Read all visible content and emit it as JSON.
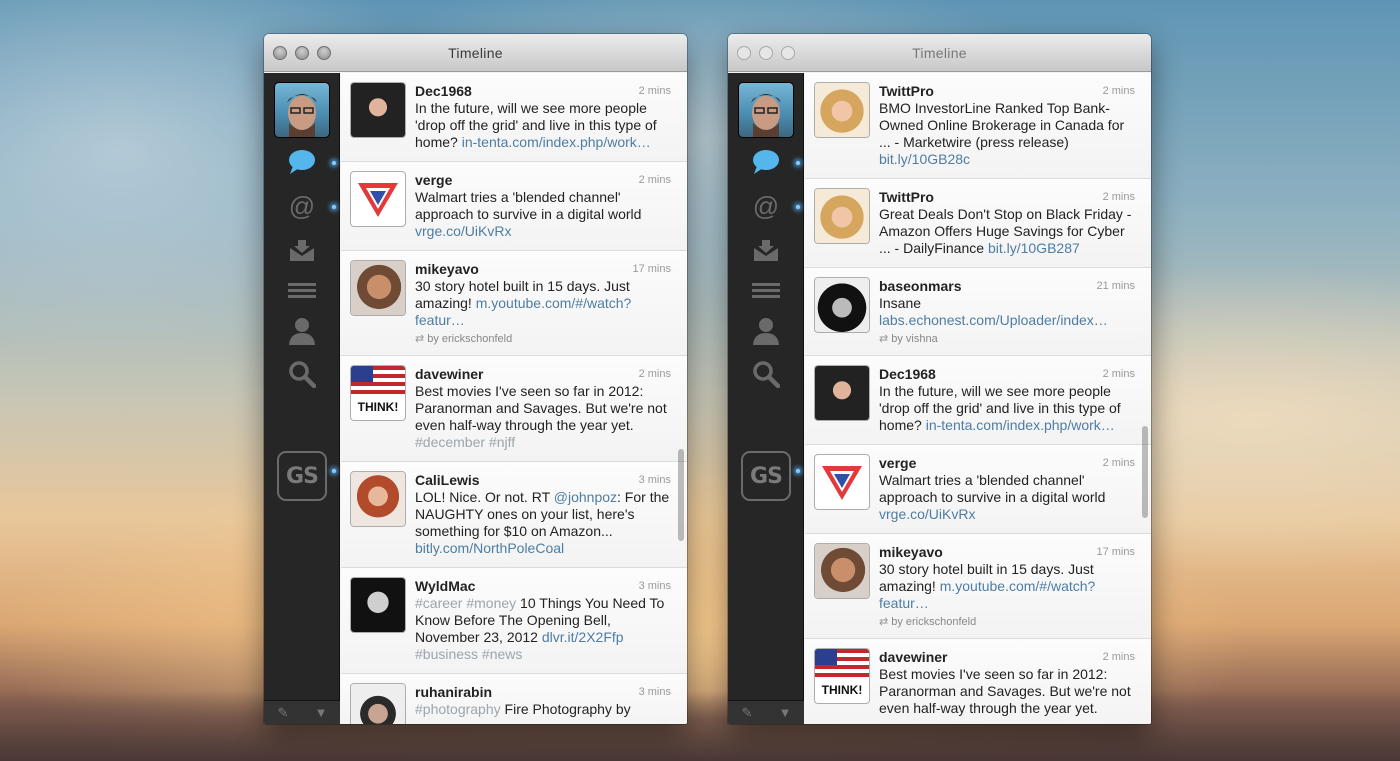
{
  "windows": [
    {
      "title": "Timeline",
      "tweets": [
        {
          "user": "Dec1968",
          "time": "2 mins",
          "avatar": "dark",
          "parts": [
            {
              "t": "In the future, will we see more people 'drop off the grid' and live in this type of home? "
            },
            {
              "t": "in-tenta.com/index.php/work…",
              "c": "link"
            }
          ]
        },
        {
          "user": "verge",
          "time": "2 mins",
          "avatar": "verge",
          "parts": [
            {
              "t": "Walmart tries a 'blended channel' approach to survive in a digital world "
            },
            {
              "t": "vrge.co/UiKvRx",
              "c": "link"
            }
          ]
        },
        {
          "user": "mikeyavo",
          "time": "17 mins",
          "avatar": "tan",
          "retweet": "by erickschonfeld",
          "parts": [
            {
              "t": "30 story hotel built in 15 days. Just amazing! "
            },
            {
              "t": "m.youtube.com/#/watch?featur…",
              "c": "link"
            }
          ]
        },
        {
          "user": "davewiner",
          "time": "2 mins",
          "avatar": "flag",
          "think": "THINK!",
          "parts": [
            {
              "t": "Best movies I've seen so far in 2012: Paranorman and Savages. But we're not even half-way through the year yet. "
            },
            {
              "t": "#december #njff",
              "c": "hash"
            }
          ]
        },
        {
          "user": "CaliLewis",
          "time": "3 mins",
          "avatar": "red",
          "parts": [
            {
              "t": "LOL! Nice. Or not. RT "
            },
            {
              "t": "@johnpoz",
              "c": "link"
            },
            {
              "t": ": For the NAUGHTY ones on your list, here's something for $10 on Amazon... "
            },
            {
              "t": "bitly.com/NorthPoleCoal",
              "c": "link"
            }
          ]
        },
        {
          "user": "WyldMac",
          "time": "3 mins",
          "avatar": "mac",
          "parts": [
            {
              "t": "#career #money",
              "c": "hash"
            },
            {
              "t": " 10 Things You Need To Know Before The Opening Bell, November 23, 2012 "
            },
            {
              "t": "dlvr.it/2X2Ffp",
              "c": "link"
            },
            {
              "t": " "
            },
            {
              "t": "#business #news",
              "c": "hash"
            }
          ]
        },
        {
          "user": "ruhanirabin",
          "time": "3 mins",
          "avatar": "rabin",
          "parts": [
            {
              "t": "#photography",
              "c": "hash"
            },
            {
              "t": " Fire Photography by"
            }
          ]
        }
      ]
    },
    {
      "title": "Timeline",
      "tweets": [
        {
          "user": "TwittPro",
          "time": "2 mins",
          "avatar": "blonde",
          "parts": [
            {
              "t": "BMO InvestorLine Ranked Top Bank-Owned Online Brokerage in Canada for ... - Marketwire (press release) "
            },
            {
              "t": "bit.ly/10GB28c",
              "c": "link"
            }
          ]
        },
        {
          "user": "TwittPro",
          "time": "2 mins",
          "avatar": "blonde",
          "parts": [
            {
              "t": "Great Deals Don't Stop on Black Friday - Amazon Offers Huge Savings for Cyber ... - DailyFinance "
            },
            {
              "t": "bit.ly/10GB287",
              "c": "link"
            }
          ]
        },
        {
          "user": "baseonmars",
          "time": "21 mins",
          "avatar": "bw",
          "retweet": "by vishna",
          "parts": [
            {
              "t": "Insane "
            },
            {
              "t": "labs.echonest.com/Uploader/index…",
              "c": "link"
            }
          ]
        },
        {
          "user": "Dec1968",
          "time": "2 mins",
          "avatar": "dark",
          "parts": [
            {
              "t": "In the future, will we see more people 'drop off the grid' and live in this type of home? "
            },
            {
              "t": "in-tenta.com/index.php/work…",
              "c": "link"
            }
          ]
        },
        {
          "user": "verge",
          "time": "2 mins",
          "avatar": "verge",
          "parts": [
            {
              "t": "Walmart tries a 'blended channel' approach to survive in a digital world "
            },
            {
              "t": "vrge.co/UiKvRx",
              "c": "link"
            }
          ]
        },
        {
          "user": "mikeyavo",
          "time": "17 mins",
          "avatar": "tan",
          "retweet": "by erickschonfeld",
          "parts": [
            {
              "t": "30 story hotel built in 15 days. Just amazing! "
            },
            {
              "t": "m.youtube.com/#/watch?featur…",
              "c": "link"
            }
          ]
        },
        {
          "user": "davewiner",
          "time": "2 mins",
          "avatar": "flag",
          "think": "THINK!",
          "parts": [
            {
              "t": "Best movies I've seen so far in 2012: Paranorman and Savages. But we're not even half-way through the year yet."
            }
          ]
        }
      ]
    }
  ],
  "sidebar": {
    "icons": [
      "speech-bubble-icon",
      "at-sign-icon",
      "inbox-icon",
      "list-icon",
      "person-icon",
      "search-icon"
    ],
    "gs_label": "GS",
    "compose_glyph": "✎",
    "menu_glyph": "▼"
  },
  "colors": {
    "link": "#4d7da4",
    "hashtag": "#9ba5ad",
    "active": "#55b6ec"
  }
}
